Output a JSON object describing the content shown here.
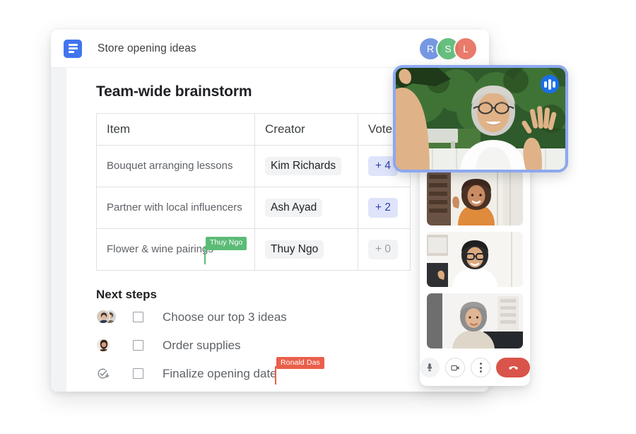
{
  "document": {
    "icon": "google-docs-icon",
    "title": "Store opening ideas",
    "collaborator_avatars": [
      {
        "initial": "R",
        "color": "#6b90e0"
      },
      {
        "initial": "S",
        "color": "#5bb974"
      },
      {
        "initial": "L",
        "color": "#e8705f"
      }
    ],
    "heading": "Team-wide brainstorm",
    "table": {
      "columns": [
        "Item",
        "Creator",
        "Votes"
      ],
      "rows": [
        {
          "item": "Bouquet arranging lessons",
          "creator": "Kim Richards",
          "votes": "+ 4",
          "votes_state": "active"
        },
        {
          "item": "Partner with local influencers",
          "creator": "Ash Ayad",
          "votes": "+ 2",
          "votes_state": "active"
        },
        {
          "item": "Flower & wine pairings",
          "creator": "Thuy Ngo",
          "votes": "+ 0",
          "votes_state": "zero"
        }
      ]
    },
    "next_steps": {
      "heading": "Next steps",
      "tasks": [
        {
          "label": "Choose our top 3 ideas",
          "assignee_icon": "two-avatars",
          "checked": false
        },
        {
          "label": "Order supplies",
          "assignee_icon": "single-avatar",
          "checked": false
        },
        {
          "label": "Finalize opening date",
          "assignee_icon": "assign-task-icon",
          "checked": false
        }
      ]
    },
    "live_cursors": [
      {
        "name": "Thuy Ngo",
        "color": "#5cbb77",
        "anchor": "flower-wine-pairings-row"
      },
      {
        "name": "Ronald Das",
        "color": "#ea5f4b",
        "anchor": "finalize-opening-date-task"
      }
    ]
  },
  "call": {
    "speaking_badge": "audio-level-icon",
    "main_participant": {
      "description": "Smiling older man waving, outdoors in a green garden, wearing a white polo shirt"
    },
    "thumbnails": [
      {
        "description": "Smiling woman with curly hair waving, orange top, bookshelf background"
      },
      {
        "description": "Smiling man with glasses in a white shirt, bright home office"
      },
      {
        "description": "Smiling woman with grey hair in a beige top, white room"
      }
    ],
    "controls": [
      {
        "name": "microphone-button",
        "icon": "mic-icon"
      },
      {
        "name": "camera-button",
        "icon": "video-camera-icon"
      },
      {
        "name": "more-options-button",
        "icon": "three-dots-icon"
      },
      {
        "name": "hang-up-button",
        "icon": "phone-hangup-icon",
        "color": "#d9544a"
      }
    ]
  }
}
